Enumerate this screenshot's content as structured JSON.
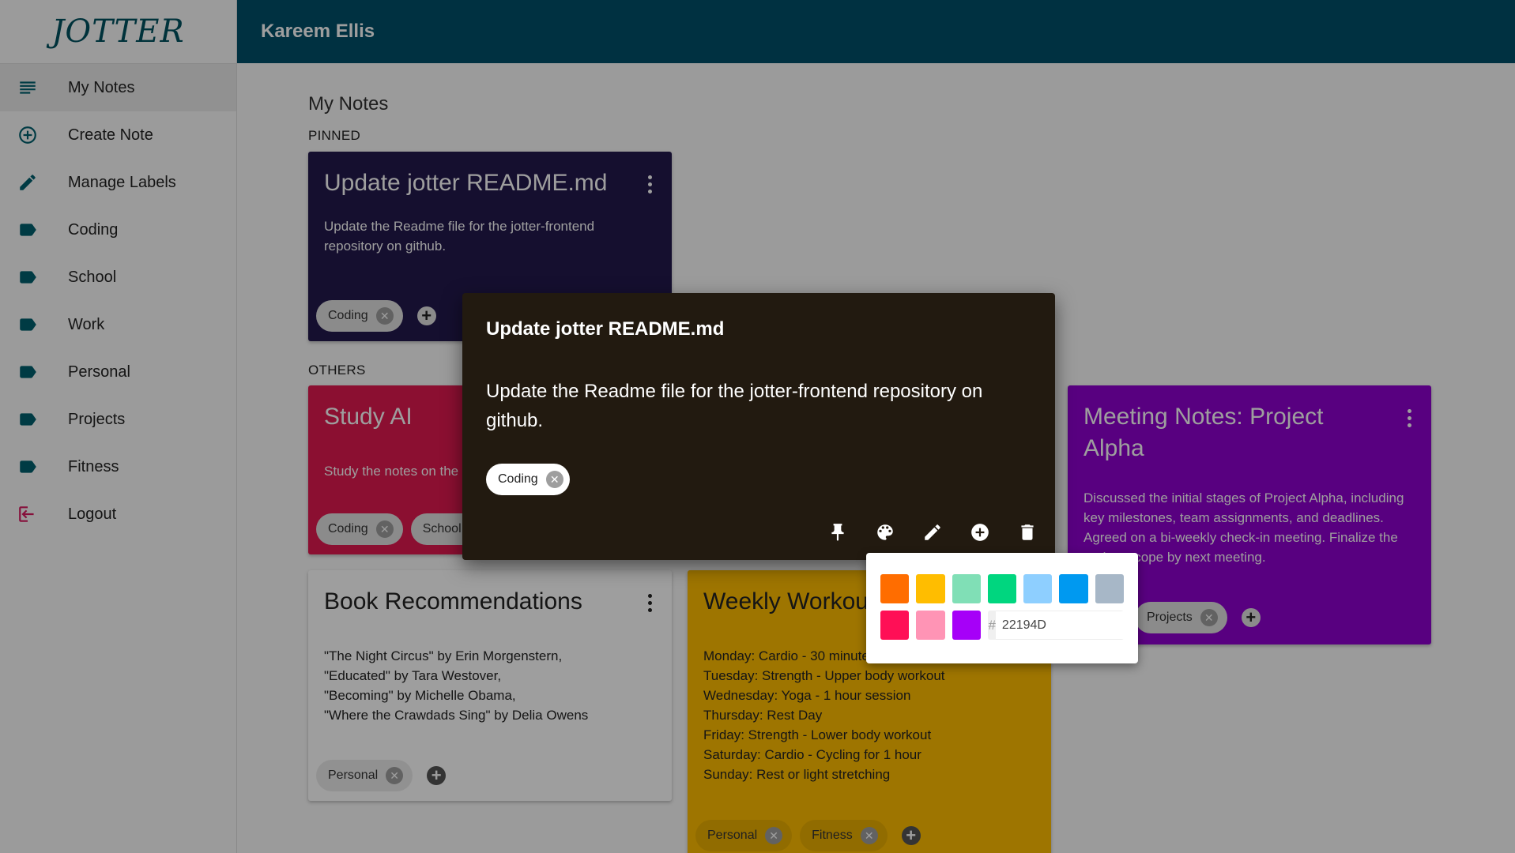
{
  "app": {
    "logo": "JOTTER",
    "user_name": "Kareem Ellis"
  },
  "sidebar": {
    "items": [
      {
        "label": "My Notes",
        "icon": "notes-list-icon"
      },
      {
        "label": "Create Note",
        "icon": "add-circle-icon"
      },
      {
        "label": "Manage Labels",
        "icon": "pencil-icon"
      },
      {
        "label": "Coding",
        "icon": "label-icon"
      },
      {
        "label": "School",
        "icon": "label-icon"
      },
      {
        "label": "Work",
        "icon": "label-icon"
      },
      {
        "label": "Personal",
        "icon": "label-icon"
      },
      {
        "label": "Projects",
        "icon": "label-icon"
      },
      {
        "label": "Fitness",
        "icon": "label-icon"
      },
      {
        "label": "Logout",
        "icon": "logout-icon"
      }
    ]
  },
  "main": {
    "title": "My Notes",
    "pinned_label": "PINNED",
    "others_label": "OTHERS"
  },
  "notes": {
    "readme": {
      "title": "Update jotter README.md",
      "body": "Update the Readme file for the jotter-frontend repository on github.",
      "labels": [
        "Coding"
      ],
      "color": "#22194d"
    },
    "study": {
      "title": "Study AI",
      "body": "Study the notes on the",
      "labels": [
        "Coding",
        "School"
      ],
      "color": "#e0194f"
    },
    "meeting": {
      "title": "Meeting Notes: Project Alpha",
      "body": "Discussed the initial stages of Project Alpha, including key milestones, team assignments, and deadlines. Agreed on a bi-weekly check-in meeting. Finalize the project scope by next meeting.",
      "labels": [
        "Projects"
      ],
      "color": "#8e00cf"
    },
    "books": {
      "title": "Book Recommendations",
      "body": "\"The Night Circus\" by Erin Morgenstern,\n\"Educated\" by Tara Westover,\n\"Becoming\" by Michelle Obama,\n\"Where the Crawdads Sing\" by Delia Owens",
      "labels": [
        "Personal"
      ],
      "color": "#ffffff"
    },
    "workout": {
      "title": "Weekly Workout",
      "body": "Monday: Cardio - 30 minutes of running\nTuesday: Strength - Upper body workout\nWednesday: Yoga - 1 hour session\nThursday: Rest Day\nFriday: Strength - Lower body workout\nSaturday: Cardio - Cycling for 1 hour\nSunday: Rest or light stretching",
      "labels": [
        "Personal",
        "Fitness"
      ],
      "color": "#ffbd00"
    }
  },
  "modal": {
    "title": "Update jotter README.md",
    "body": "Update the Readme file for the jotter-frontend repository on github.",
    "label": "Coding",
    "actions": [
      "pin-icon",
      "palette-icon",
      "pencil-icon",
      "add-circle-icon",
      "trash-icon"
    ]
  },
  "color_picker": {
    "swatches_row1": [
      "#ff6d00",
      "#ffbd00",
      "#80dfb6",
      "#00d67f",
      "#8ecfff",
      "#0099f0",
      "#a7b7c7"
    ],
    "swatches_row2": [
      "#ff0f56",
      "#ff94b5",
      "#a600f8"
    ],
    "hash": "#",
    "hex_value": "22194D"
  }
}
